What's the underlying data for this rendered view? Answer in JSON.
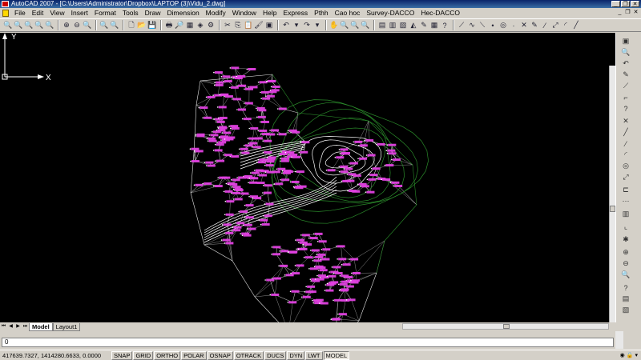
{
  "window": {
    "title": "AutoCAD 2007 - [C:\\Users\\Administrator\\Dropbox\\LAPTOP (3)\\Vidu_2.dwg]"
  },
  "menu": [
    "File",
    "Edit",
    "View",
    "Insert",
    "Format",
    "Tools",
    "Draw",
    "Dimension",
    "Modify",
    "Window",
    "Help",
    "Express",
    "Pthh",
    "Cao hoc",
    "Survey-DACCO",
    "Hec-DACCO"
  ],
  "tabs": [
    "Model",
    "Layout1"
  ],
  "command": {
    "value": "0"
  },
  "status": {
    "coordinates": "417639.7327, 1414280.6633, 0.0000",
    "toggles": [
      "SNAP",
      "GRID",
      "ORTHO",
      "POLAR",
      "OSNAP",
      "OTRACK",
      "DUCS",
      "DYN",
      "LWT",
      "MODEL"
    ]
  },
  "ucs": {
    "x_label": "X",
    "y_label": "Y"
  },
  "colors": {
    "canvas": "#000000",
    "labels": "#e040e0",
    "contours": "#ffffff",
    "triangles": "#e8e8e8",
    "boundary": "#2a8a2a"
  }
}
